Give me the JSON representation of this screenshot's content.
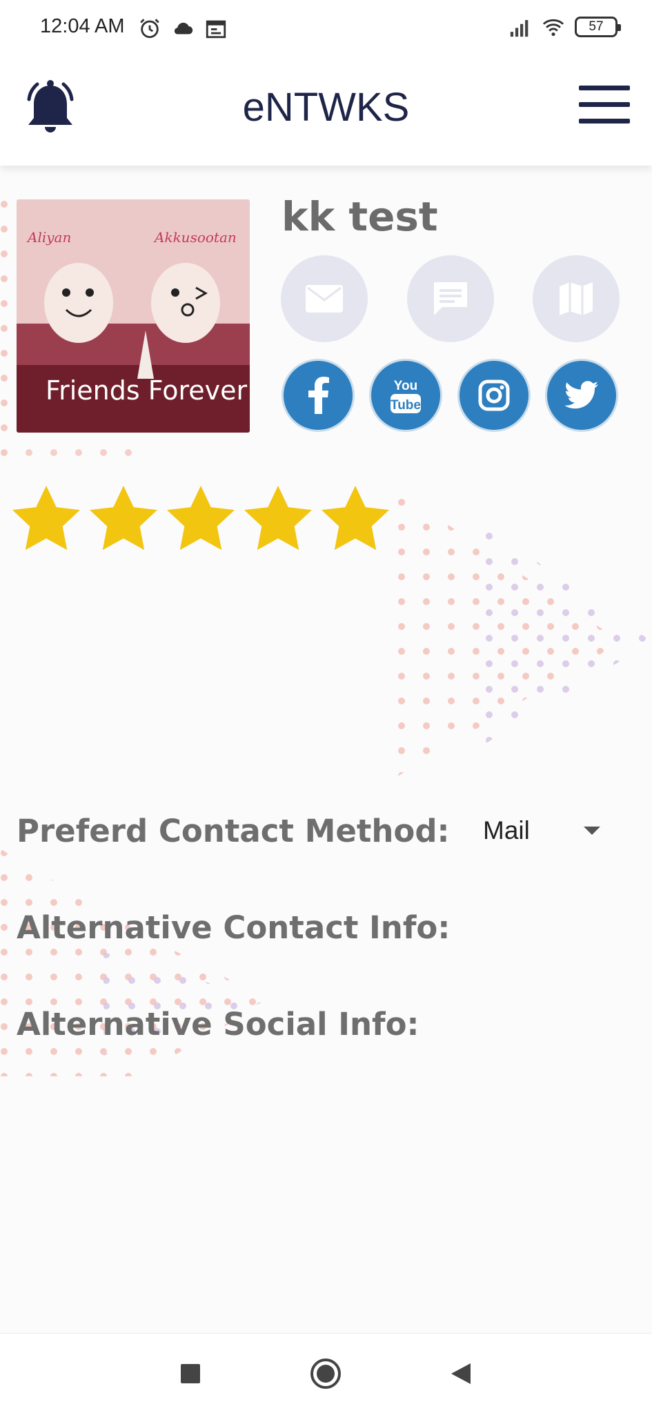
{
  "status_bar": {
    "time": "12:04 AM",
    "battery": "57",
    "icons_left": [
      "alarm-icon",
      "cloud-icon",
      "calendar-icon"
    ],
    "icons_right": [
      "signal-icon",
      "wifi-icon",
      "battery-icon"
    ]
  },
  "header": {
    "title": "eNTWKS",
    "left_icon": "bell-icon",
    "right_icon": "menu-icon"
  },
  "profile": {
    "name": "kk test",
    "photo": {
      "caption": "Friends Forever",
      "left_name": "Aliyan",
      "right_name": "Akkusootan"
    },
    "contact_actions": [
      "mail-icon",
      "message-icon",
      "map-icon"
    ],
    "social_links": [
      "facebook-icon",
      "youtube-icon",
      "instagram-icon",
      "twitter-icon"
    ],
    "rating": 5,
    "rating_max": 5
  },
  "fields": {
    "preferred_contact_label": "Preferd Contact Method:",
    "preferred_contact_value": "Mail",
    "alt_contact_label": "Alternative Contact Info:",
    "alt_social_label": "Alternative Social Info:"
  },
  "colors": {
    "brand_navy": "#1f2548",
    "social_blue": "#2d7fbf",
    "star_yellow": "#f2c511",
    "action_gray": "#e4e5ee"
  },
  "nav": {
    "buttons": [
      "recents-icon",
      "home-icon",
      "back-icon"
    ]
  }
}
